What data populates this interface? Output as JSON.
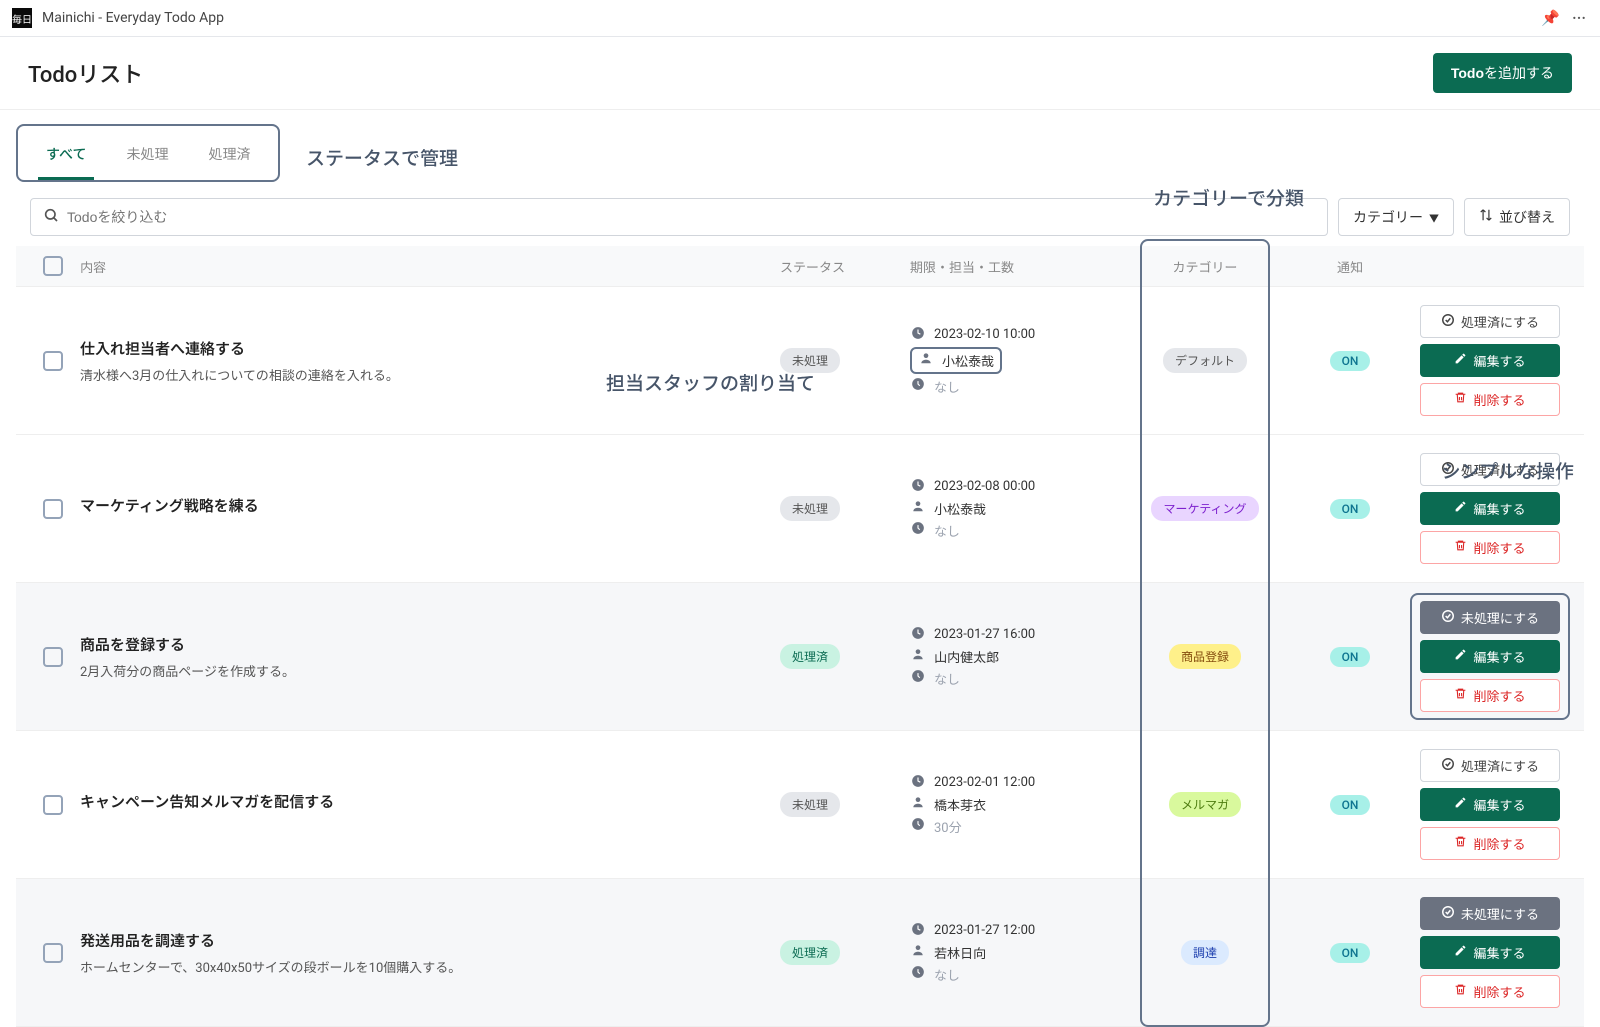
{
  "app": {
    "title": "Mainichi - Everyday Todo App"
  },
  "page": {
    "title": "Todoリスト",
    "add_button_prefix": "Todo",
    "add_button_suffix": "を追加する"
  },
  "tabs": {
    "all": "すべて",
    "pending": "未処理",
    "done": "処理済"
  },
  "filters": {
    "search_placeholder": "Todoを絞り込む",
    "category_label": "カテゴリー",
    "sort_label": "並び替え"
  },
  "columns": {
    "content": "内容",
    "status": "ステータス",
    "meta": "期限・担当・工数",
    "category": "カテゴリー",
    "notify": "通知"
  },
  "status_labels": {
    "pending": "未処理",
    "done": "処理済"
  },
  "notify_on": "ON",
  "action_labels": {
    "mark_done": "処理済にする",
    "mark_pending": "未処理にする",
    "edit": "編集する",
    "delete": "削除する"
  },
  "annotations": {
    "status_manage": "ステータスで管理",
    "category_sort": "カテゴリーで分類",
    "assign_staff": "担当スタッフの割り当て",
    "simple_ops": "シンプルな操作"
  },
  "categories": {
    "default": {
      "label": "デフォルト",
      "bg": "#e5e7eb",
      "fg": "#555"
    },
    "marketing": {
      "label": "マーケティング",
      "bg": "#e9d5ff",
      "fg": "#7e22ce"
    },
    "product_reg": {
      "label": "商品登録",
      "bg": "#fef08a",
      "fg": "#854d0e"
    },
    "mailmag": {
      "label": "メルマガ",
      "bg": "#d9f99d",
      "fg": "#4d7c0f"
    },
    "procurement": {
      "label": "調達",
      "bg": "#dbeafe",
      "fg": "#1e40af"
    }
  },
  "todos": [
    {
      "title": "仕入れ担当者へ連絡する",
      "desc": "清水様へ3月の仕入れについての相談の連絡を入れる。",
      "status": "pending",
      "due": "2023-02-10 10:00",
      "assignee": "小松泰哉",
      "effort": "なし",
      "category": "default",
      "assignee_highlight": true
    },
    {
      "title": "マーケティング戦略を練る",
      "desc": "",
      "status": "pending",
      "due": "2023-02-08 00:00",
      "assignee": "小松泰哉",
      "effort": "なし",
      "category": "marketing"
    },
    {
      "title": "商品を登録する",
      "desc": "2月入荷分の商品ページを作成する。",
      "status": "done",
      "due": "2023-01-27 16:00",
      "assignee": "山内健太郎",
      "effort": "なし",
      "category": "product_reg"
    },
    {
      "title": "キャンペーン告知メルマガを配信する",
      "desc": "",
      "status": "pending",
      "due": "2023-02-01 12:00",
      "assignee": "橋本芽衣",
      "effort": "30分",
      "category": "mailmag"
    },
    {
      "title": "発送用品を調達する",
      "desc": "ホームセンターで、30x40x50サイズの段ボールを10個購入する。",
      "status": "done",
      "due": "2023-01-27 12:00",
      "assignee": "若林日向",
      "effort": "なし",
      "category": "procurement"
    }
  ]
}
